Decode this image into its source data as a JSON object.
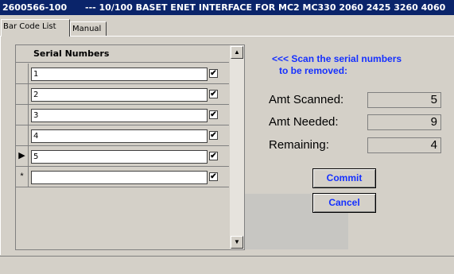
{
  "titlebar": {
    "part_number": "2600566-100",
    "title": "--- 10/100 BASET ENET INTERFACE FOR MC2 MC330 2060 2425 3260 4060"
  },
  "tabs": [
    {
      "label": "Bar Code List",
      "active": true
    },
    {
      "label": "Manual",
      "active": false
    }
  ],
  "list": {
    "header": "Serial Numbers",
    "rows": [
      {
        "marker": "",
        "serial": "1",
        "checked": true
      },
      {
        "marker": "",
        "serial": "2",
        "checked": true
      },
      {
        "marker": "",
        "serial": "3",
        "checked": true
      },
      {
        "marker": "",
        "serial": "4",
        "checked": true
      },
      {
        "marker": "▶",
        "serial": "5",
        "checked": true
      },
      {
        "marker": "*",
        "serial": "",
        "checked": true
      }
    ]
  },
  "instruction": {
    "line1": "<<< Scan the serial numbers",
    "line2": "to be removed:"
  },
  "stats": {
    "scanned_label": "Amt Scanned:",
    "scanned_value": "5",
    "needed_label": "Amt Needed:",
    "needed_value": "9",
    "remaining_label": "Remaining:",
    "remaining_value": "4"
  },
  "buttons": {
    "commit": "Commit",
    "cancel": "Cancel"
  },
  "colors": {
    "titlebar_bg": "#0a246a",
    "accent_blue": "#1530ff",
    "window_bg": "#d4d0c8"
  },
  "icons": {
    "cursor": "arrow-cursor-icon",
    "row_pointer": "row-pointer-icon",
    "new_row": "new-row-asterisk-icon"
  }
}
